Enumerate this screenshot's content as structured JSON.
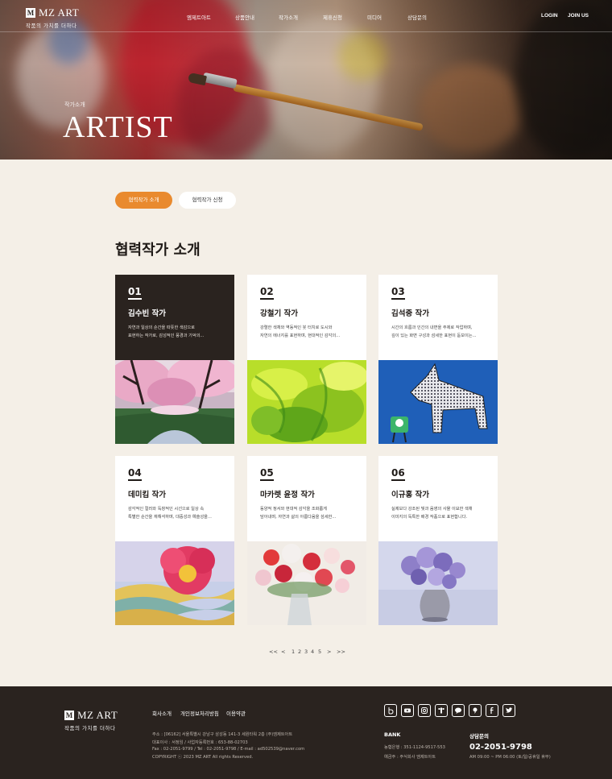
{
  "brand": {
    "logo_mark": "M",
    "name": "MZ ART",
    "tagline": "작품의 가치를 더하다"
  },
  "nav": {
    "menu": [
      "엠제트아트",
      "상품안내",
      "작가소개",
      "제휴신청",
      "미디어",
      "상담문의"
    ],
    "login": "LOGIN",
    "join": "JOIN US"
  },
  "hero": {
    "subtitle": "작가소개",
    "title": "ARTIST"
  },
  "tabs": {
    "active": "협력작가 소개",
    "inactive": "협력작가 신청"
  },
  "section_title": "협력작가 소개",
  "cards": [
    {
      "num": "01",
      "name": "김수빈 작가",
      "desc1": "자연과 일상의 순간을 따뜻한 색감으로",
      "desc2": "표현하는 작가로, 감성적인 풍경과 기억의...",
      "art": "cherry-blossom-painting"
    },
    {
      "num": "02",
      "name": "강철기 작가",
      "desc1": "강렬한 색채와 역동적인 붓 터치로 도시와",
      "desc2": "자연의 에너지를 표현하며, 현대적인 감각의...",
      "art": "green-abstract-painting"
    },
    {
      "num": "03",
      "name": "김석중 작가",
      "desc1": "시간의 흐름과 인간의 내면을 주제로 작업하며,",
      "desc2": "깊이 있는 화면 구성과 섬세한 표현이 돋보이는...",
      "art": "dotted-horse-painting"
    },
    {
      "num": "04",
      "name": "데미킴 작가",
      "desc1": "감각적인 컬러와 독창적인 시선으로 일상 속",
      "desc2": "특별한 순간을 재해석하며, 대중성과 예술성을...",
      "art": "red-flower-painting"
    },
    {
      "num": "05",
      "name": "마카렛 윤정 작가",
      "desc1": "동양적 정서와 현대적 감각을 조화롭게",
      "desc2": "담아내며, 자연과 삶의 아름다움을 섬세한...",
      "art": "flower-bouquet-painting"
    },
    {
      "num": "06",
      "name": "이규홍 작가",
      "desc1": "실제보다 강조된 빛과 음영의 사물 이묘한 색채",
      "desc2": "이미지의 독특한 배경 작품으로 표현합니다.",
      "art": "purple-flower-vase-painting"
    }
  ],
  "pagination": {
    "first": "<<",
    "prev": "<",
    "pages": [
      "1",
      "2",
      "3",
      "4",
      "5"
    ],
    "next": ">",
    "last": ">>"
  },
  "footer": {
    "links": [
      "회사소개",
      "개인정보처리방침",
      "이용약관"
    ],
    "address": "주소 : [06162] 서울특별시 강남구 삼성동 141-3 세원타워 2층 (주)엠제트아트",
    "ceo": "대표이사 : 서정임 / 사업자등록번호 : 653-88-02703",
    "contact": "Fax : 02-2051-9799 / Tel : 02-2051-9798 / E-mail : ad502539@naver.com",
    "copyright": "COPYRIGHT ⓒ 2023 MZ ART All rights Reserved.",
    "social": [
      "blog-icon",
      "youtube-icon",
      "instagram-icon",
      "tiktok-icon",
      "talk-icon",
      "story-icon",
      "facebook-icon",
      "twitter-icon"
    ],
    "bank_title": "BANK",
    "bank_account": "농협은행 : 351-1124-9517-553",
    "bank_holder": "예금주 : 주식회사 엠제트아트",
    "cs_title": "상담문의",
    "cs_phone": "02-2051-9798",
    "cs_hours": "AM 09:00 ~ PM 06:00 (토/일/공휴일 휴무)"
  }
}
